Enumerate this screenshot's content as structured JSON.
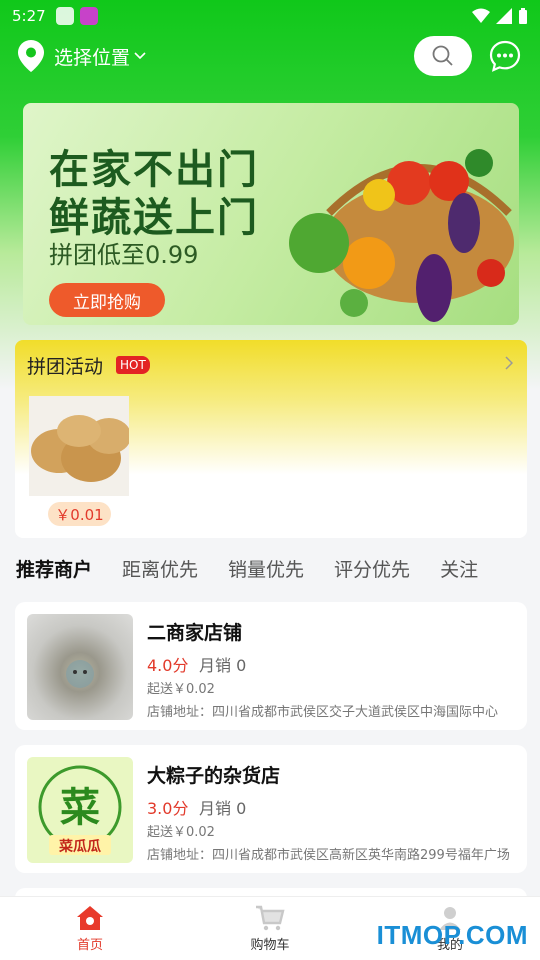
{
  "status_bar": {
    "time": "5:27"
  },
  "header": {
    "location_label": "选择位置"
  },
  "banner": {
    "line1": "在家不出门",
    "line2": "鲜蔬送上门",
    "line3": "拼团低至0.99",
    "button": "立即抢购"
  },
  "group_buy": {
    "title": "拼团活动",
    "badge": "HOT",
    "product_price": "￥0.01"
  },
  "tabs": [
    {
      "label": "推荐商户",
      "active": true
    },
    {
      "label": "距离优先"
    },
    {
      "label": "销量优先"
    },
    {
      "label": "评分优先"
    },
    {
      "label": "关注"
    }
  ],
  "shops": [
    {
      "name": "二商家店铺",
      "rating": "4.0分",
      "sales": "月销 0",
      "delivery": "起送￥0.02",
      "address": "店铺地址：四川省成都市武侯区交子大道武侯区中海国际中心"
    },
    {
      "name": "大粽子的杂货店",
      "rating": "3.0分",
      "sales": "月销 0",
      "delivery": "起送￥0.02",
      "address": "店铺地址：四川省成都市武侯区高新区英华南路299号福年广场"
    }
  ],
  "shop_logo_text": {
    "big": "菜",
    "small": "菜瓜瓜"
  },
  "bottom_nav": [
    {
      "label": "首页",
      "active": true
    },
    {
      "label": "购物车"
    },
    {
      "label": "我的"
    }
  ],
  "watermark": "ITMOP.COM",
  "colors": {
    "brand_green": "#10c81a",
    "accent_red": "#e23a2b",
    "button_orange": "#ee5a2b"
  }
}
